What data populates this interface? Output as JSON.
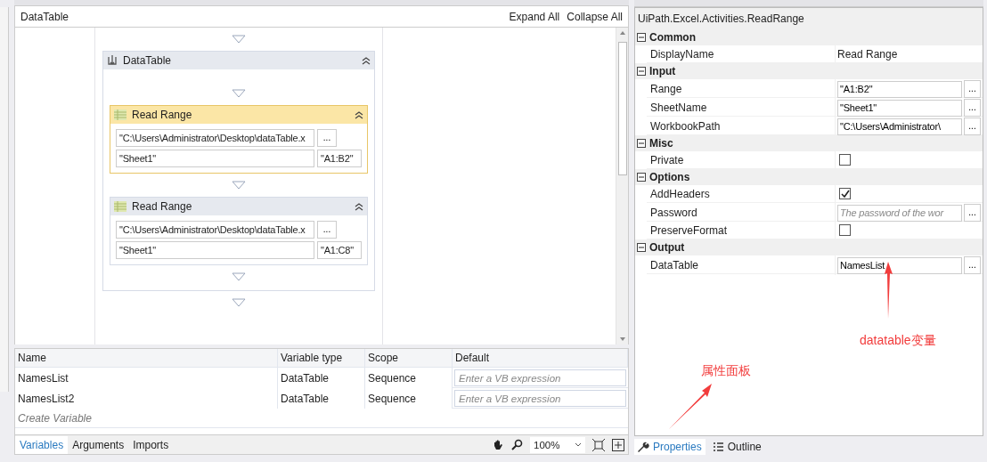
{
  "designer": {
    "title": "DataTable",
    "actions": [
      "Expand All",
      "Collapse All"
    ],
    "sequence": {
      "title": "DataTable",
      "activities": [
        {
          "title": "Read Range",
          "selected": true,
          "path": "\"C:\\Users\\Administrator\\Desktop\\dataTable.x",
          "browse": "...",
          "sheet": "\"Sheet1\"",
          "range": "\"A1:B2\""
        },
        {
          "title": "Read Range",
          "selected": false,
          "path": "\"C:\\Users\\Administrator\\Desktop\\dataTable.x",
          "browse": "...",
          "sheet": "\"Sheet1\"",
          "range": "\"A1:C8\""
        }
      ]
    }
  },
  "variables": {
    "columns": [
      "Name",
      "Variable type",
      "Scope",
      "Default"
    ],
    "rows": [
      {
        "name": "NamesList",
        "type": "DataTable",
        "scope": "Sequence",
        "default_placeholder": "Enter a VB expression"
      },
      {
        "name": "NamesList2",
        "type": "DataTable",
        "scope": "Sequence",
        "default_placeholder": "Enter a VB expression"
      }
    ],
    "create": "Create Variable"
  },
  "bottom_tabs": [
    {
      "label": "Variables",
      "selected": true
    },
    {
      "label": "Arguments",
      "selected": false
    },
    {
      "label": "Imports",
      "selected": false
    }
  ],
  "zoom": "100%",
  "properties": {
    "title": "UiPath.Excel.Activities.ReadRange",
    "categories": [
      {
        "name": "Common",
        "expanded": true,
        "rows": [
          {
            "kind": "text",
            "label": "DisplayName",
            "value": "Read Range"
          }
        ]
      },
      {
        "name": "Input",
        "expanded": true,
        "rows": [
          {
            "kind": "field",
            "label": "Range",
            "value": "\"A1:B2\"",
            "browse": "..."
          },
          {
            "kind": "field",
            "label": "SheetName",
            "value": "\"Sheet1\"",
            "browse": "..."
          },
          {
            "kind": "field",
            "label": "WorkbookPath",
            "value": "\"C:\\Users\\Administrator\\",
            "browse": "..."
          }
        ]
      },
      {
        "name": "Misc",
        "expanded": true,
        "rows": [
          {
            "kind": "checkbox",
            "label": "Private",
            "checked": false
          }
        ]
      },
      {
        "name": "Options",
        "expanded": true,
        "rows": [
          {
            "kind": "checkbox",
            "label": "AddHeaders",
            "checked": true
          },
          {
            "kind": "field",
            "label": "Password",
            "placeholder": "The password of the wor",
            "browse": "..."
          },
          {
            "kind": "checkbox",
            "label": "PreserveFormat",
            "checked": false
          }
        ]
      },
      {
        "name": "Output",
        "expanded": true,
        "rows": [
          {
            "kind": "field",
            "label": "DataTable",
            "value": "NamesList",
            "browse": "..."
          }
        ]
      }
    ]
  },
  "panel_tabs": [
    {
      "label": "Properties",
      "selected": true
    },
    {
      "label": "Outline",
      "selected": false
    }
  ],
  "annotations": [
    "datatable变量",
    "属性面板"
  ]
}
